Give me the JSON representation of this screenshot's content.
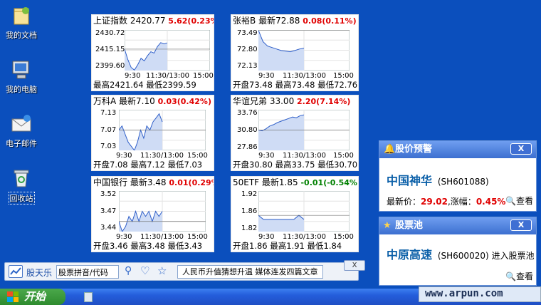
{
  "desktop": {
    "icons": [
      {
        "label": "我的文档",
        "icon": "my-documents-icon"
      },
      {
        "label": "我的电脑",
        "icon": "my-computer-icon"
      },
      {
        "label": "电子邮件",
        "icon": "email-icon"
      },
      {
        "label": "回收站",
        "icon": "recycle-bin-icon"
      }
    ]
  },
  "widgets": [
    {
      "name": "上证指数",
      "price": "2420.77",
      "change": "5.62(0.23%)",
      "dir": "up",
      "y_ticks": [
        "2430.72",
        "2415.15",
        "2399.60"
      ],
      "x_ticks": [
        "9:30",
        "11:30/13:00",
        "15:00"
      ],
      "footer": "最高2421.64 最低2399.59"
    },
    {
      "name": "张裕B",
      "price": "最新72.88",
      "change": "0.08(0.11%)",
      "dir": "up",
      "y_ticks": [
        "73.49",
        "72.80",
        "72.13"
      ],
      "x_ticks": [
        "9:30",
        "11:30/13:00",
        "15:00"
      ],
      "footer": "开盘73.48 最高73.48 最低72.76"
    },
    {
      "name": "万科A",
      "price": "最新7.10",
      "change": "0.03(0.42%)",
      "dir": "up",
      "y_ticks": [
        "7.13",
        "7.07",
        "7.03"
      ],
      "x_ticks": [
        "9:30",
        "11:30/13:00",
        "15:00"
      ],
      "footer": "开盘7.08 最高7.12 最低7.03"
    },
    {
      "name": "华谊兄弟",
      "price": "33.00",
      "change": "2.20(7.14%)",
      "dir": "up",
      "y_ticks": [
        "33.76",
        "30.80",
        "27.86"
      ],
      "x_ticks": [
        "9:30",
        "11:30/13:00",
        "15:00"
      ],
      "footer": "开盘30.80 最高33.75 最低30.70"
    },
    {
      "name": "中国银行",
      "price": "最新3.48",
      "change": "0.01(0.29%)",
      "dir": "up",
      "y_ticks": [
        "3.52",
        "3.47",
        "3.44"
      ],
      "x_ticks": [
        "9:30",
        "11:30/13:00",
        "15:00"
      ],
      "footer": "开盘3.46 最高3.48 最低3.43"
    },
    {
      "name": "50ETF",
      "price": "最新1.85",
      "change": "-0.01(-0.54%)",
      "dir": "dn",
      "y_ticks": [
        "1.92",
        "1.86",
        "1.82"
      ],
      "x_ticks": [
        "9:30",
        "11:30/13:00",
        "15:00"
      ],
      "footer": "开盘1.86 最高1.91 最低1.84"
    }
  ],
  "chart_data": [
    {
      "type": "area",
      "title": "上证指数",
      "x": [
        "9:30",
        "11:30/13:00",
        "15:00"
      ],
      "ylim": [
        2399.6,
        2430.72
      ],
      "series": [
        {
          "values": [
            2416,
            2408,
            2402,
            2400,
            2404,
            2409,
            2407,
            2411,
            2414,
            2413,
            2418,
            2421,
            2420,
            2420.77
          ]
        }
      ]
    },
    {
      "type": "area",
      "title": "张裕B",
      "x": [
        "9:30",
        "11:30/13:00",
        "15:00"
      ],
      "ylim": [
        72.13,
        73.49
      ],
      "series": [
        {
          "values": [
            73.48,
            73.1,
            72.95,
            72.9,
            72.85,
            72.8,
            72.78,
            72.76,
            72.8,
            72.85,
            72.88
          ]
        }
      ]
    },
    {
      "type": "area",
      "title": "万科A",
      "x": [
        "9:30",
        "11:30/13:00",
        "15:00"
      ],
      "ylim": [
        7.03,
        7.13
      ],
      "series": [
        {
          "values": [
            7.08,
            7.09,
            7.07,
            7.05,
            7.04,
            7.03,
            7.05,
            7.08,
            7.06,
            7.09,
            7.08,
            7.1,
            7.11,
            7.12,
            7.1
          ]
        }
      ]
    },
    {
      "type": "area",
      "title": "华谊兄弟",
      "x": [
        "9:30",
        "11:30/13:00",
        "15:00"
      ],
      "ylim": [
        27.86,
        33.76
      ],
      "series": [
        {
          "values": [
            30.8,
            30.7,
            31.0,
            31.4,
            31.6,
            31.9,
            32.1,
            32.3,
            32.5,
            32.7,
            32.6,
            32.9,
            33.0
          ]
        }
      ]
    },
    {
      "type": "area",
      "title": "中国银行",
      "x": [
        "9:30",
        "11:30/13:00",
        "15:00"
      ],
      "ylim": [
        3.44,
        3.52
      ],
      "series": [
        {
          "values": [
            3.46,
            3.44,
            3.45,
            3.47,
            3.46,
            3.48,
            3.46,
            3.48,
            3.47,
            3.48,
            3.46,
            3.48,
            3.47,
            3.48
          ]
        }
      ]
    },
    {
      "type": "area",
      "title": "50ETF",
      "x": [
        "9:30",
        "11:30/13:00",
        "15:00"
      ],
      "ylim": [
        1.82,
        1.92
      ],
      "series": [
        {
          "values": [
            1.86,
            1.85,
            1.85,
            1.85,
            1.85,
            1.85,
            1.85,
            1.85,
            1.86,
            1.85
          ]
        }
      ]
    }
  ],
  "alert_panel": {
    "title": "股价预警",
    "close": "X",
    "stock_name": "中国神华",
    "stock_code": "(SH601088)",
    "price_label": "最新价：",
    "price": "29.02",
    "change_label": ",涨幅：",
    "change": "0.45%",
    "view_label": "查看"
  },
  "pool_panel": {
    "title": "股票池",
    "close": "X",
    "stock_name": "中原高速",
    "stock_code": "(SH600020)",
    "action_text": "进入股票池",
    "view_label": "查看"
  },
  "toolbar": {
    "brand": "股天乐",
    "search_placeholder": "股票拼音/代码",
    "news_text": "人民币升值猜想升温 媒体连发四篇文章",
    "close": "X"
  },
  "taskbar": {
    "start_label": "开始",
    "watermark": "www.arpun.com"
  },
  "colors": {
    "desktop": "#0b4fbd",
    "up": "#e00000",
    "down": "#008000",
    "chart_fill": "#cfdcf5",
    "chart_line": "#2f5fc9"
  }
}
